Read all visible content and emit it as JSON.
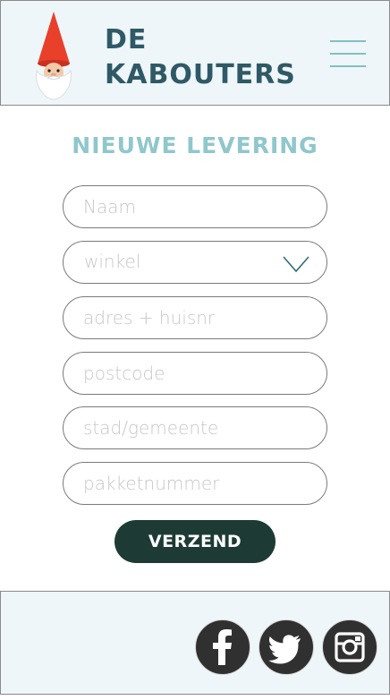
{
  "header": {
    "brand_line1": "DE",
    "brand_line2": "KABOUTERS",
    "logo_icon": "gnome-icon",
    "menu_icon": "hamburger-menu-icon"
  },
  "form": {
    "title": "NIEUWE LEVERING",
    "fields": [
      {
        "name": "naam",
        "placeholder": "Naam",
        "value": ""
      },
      {
        "name": "winkel",
        "placeholder": "winkel",
        "type": "select",
        "selected": "winkel"
      },
      {
        "name": "adres",
        "placeholder": "adres + huisnr",
        "value": ""
      },
      {
        "name": "postcode",
        "placeholder": "postcode",
        "value": ""
      },
      {
        "name": "stad",
        "placeholder": "stad/gemeente",
        "value": ""
      },
      {
        "name": "pakketnummer",
        "placeholder": "pakketnummer",
        "value": ""
      }
    ],
    "submit_label": "VERZEND"
  },
  "footer": {
    "social": [
      {
        "name": "facebook",
        "icon": "facebook-icon"
      },
      {
        "name": "twitter",
        "icon": "twitter-icon"
      },
      {
        "name": "instagram",
        "icon": "instagram-icon"
      }
    ]
  },
  "colors": {
    "brand": "#2f5966",
    "accent": "#8fc7cc",
    "button": "#1d3b34",
    "header_bg": "#eef6f9"
  }
}
